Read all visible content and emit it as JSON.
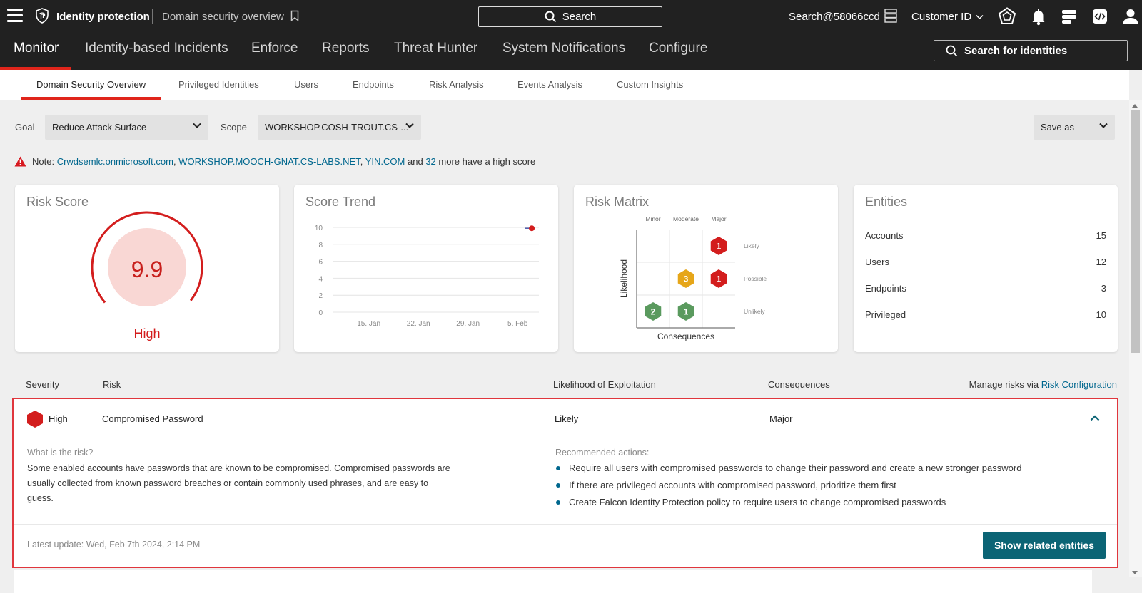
{
  "topbar": {
    "app_name": "Identity protection",
    "breadcrumb": "Domain security overview",
    "search_label": "Search",
    "user": "Search@58066ccd",
    "customer_label": "Customer ID"
  },
  "main_nav": {
    "items": [
      "Monitor",
      "Identity-based Incidents",
      "Enforce",
      "Reports",
      "Threat Hunter",
      "System Notifications",
      "Configure"
    ],
    "active": "Monitor",
    "search_identities": "Search for identities"
  },
  "sub_nav": {
    "items": [
      "Domain Security Overview",
      "Privileged Identities",
      "Users",
      "Endpoints",
      "Risk Analysis",
      "Events Analysis",
      "Custom Insights"
    ],
    "active": "Domain Security Overview"
  },
  "filters": {
    "goal_label": "Goal",
    "goal_value": "Reduce Attack Surface",
    "scope_label": "Scope",
    "scope_value": "WORKSHOP.COSH-TROUT.CS-...",
    "save_as": "Save as"
  },
  "note": {
    "prefix": "Note:",
    "domain1": "Crwdsemlc.onmicrosoft.com",
    "comma1": ",",
    "domain2": "WORKSHOP.MOOCH-GNAT.CS-LABS.NET",
    "comma2": ",",
    "domain3": "YIN.COM",
    "and_text": "and",
    "count": "32",
    "suffix": "more have a high score"
  },
  "risk_score": {
    "title": "Risk Score",
    "value": "9.9",
    "label": "High",
    "fraction": 0.99
  },
  "score_trend": {
    "title": "Score Trend"
  },
  "chart_data": {
    "type": "line",
    "title": "Score Trend",
    "x_ticks": [
      "15. Jan",
      "22. Jan",
      "29. Jan",
      "5. Feb"
    ],
    "y_ticks": [
      0,
      2,
      4,
      6,
      8,
      10
    ],
    "ylim": [
      0,
      10
    ],
    "xlim": [
      "2024-01-10",
      "2024-02-08"
    ],
    "series": [
      {
        "values": [
          [
            "2024-02-06",
            9.9
          ],
          [
            "2024-02-07",
            9.9
          ]
        ],
        "color": "#4a57a8"
      }
    ],
    "grid": true
  },
  "risk_matrix": {
    "title": "Risk Matrix",
    "columns": [
      "Minor",
      "Moderate",
      "Major"
    ],
    "rows": [
      "Likely",
      "Possible",
      "Unlikely"
    ],
    "ylabel": "Likelihood",
    "xlabel": "Consequences",
    "cells": [
      {
        "row": "Likely",
        "col": "Major",
        "count": "1",
        "color": "#d31d1d"
      },
      {
        "row": "Possible",
        "col": "Moderate",
        "count": "3",
        "color": "#e6a619"
      },
      {
        "row": "Possible",
        "col": "Major",
        "count": "1",
        "color": "#d31d1d"
      },
      {
        "row": "Unlikely",
        "col": "Minor",
        "count": "2",
        "color": "#5a9a5e"
      },
      {
        "row": "Unlikely",
        "col": "Moderate",
        "count": "1",
        "color": "#5a9a5e"
      }
    ]
  },
  "entities": {
    "title": "Entities",
    "rows": [
      {
        "label": "Accounts",
        "value": "15"
      },
      {
        "label": "Users",
        "value": "12"
      },
      {
        "label": "Endpoints",
        "value": "3"
      },
      {
        "label": "Privileged",
        "value": "10"
      }
    ]
  },
  "risk_table": {
    "headers": {
      "severity": "Severity",
      "risk": "Risk",
      "likelihood": "Likelihood of Exploitation",
      "consequences": "Consequences",
      "manage_prefix": "Manage risks via",
      "manage_link": "Risk Configuration"
    },
    "row": {
      "severity": "High",
      "risk": "Compromised Password",
      "likelihood": "Likely",
      "consequences": "Major",
      "what_title": "What is the risk?",
      "what_body": "Some enabled accounts have passwords that are known to be compromised. Compromised passwords are usually collected from known password breaches or contain commonly used phrases, and are easy to guess.",
      "actions_title": "Recommended actions:",
      "actions": [
        "Require all users with compromised passwords to change their password and create a new stronger password",
        "If there are privileged accounts with compromised password, prioritize them first",
        "Create Falcon Identity Protection policy to require users to change compromised passwords"
      ],
      "latest_update": "Latest update: Wed, Feb 7th 2024, 2:14 PM",
      "button": "Show related entities"
    }
  },
  "colors": {
    "accent_red": "#e0251b",
    "button_teal": "#0b6475",
    "link_blue": "#00678e"
  }
}
